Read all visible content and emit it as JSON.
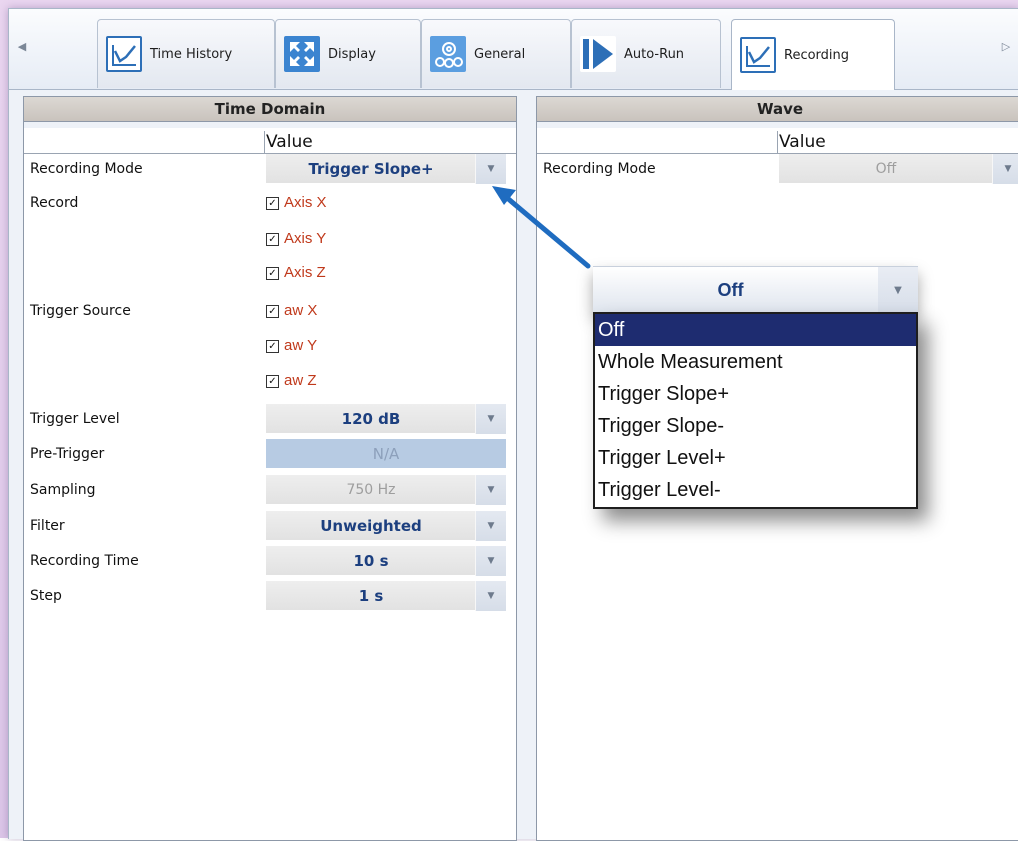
{
  "tabs": {
    "scroll_left": "◀",
    "scroll_right": "▷",
    "items": [
      {
        "label": "Time History",
        "icon": "line-chart-icon"
      },
      {
        "label": "Display",
        "icon": "expand-arrows-icon"
      },
      {
        "label": "General",
        "icon": "gears-icon"
      },
      {
        "label": "Auto-Run",
        "icon": "play-icon"
      },
      {
        "label": "Recording",
        "icon": "line-chart-icon",
        "active": true
      }
    ]
  },
  "time_domain": {
    "title": "Time Domain",
    "value_header": "Value",
    "recording_mode": {
      "label": "Recording Mode",
      "value": "Trigger Slope+"
    },
    "record": {
      "label": "Record",
      "items": [
        {
          "label": "Axis X",
          "checked": true
        },
        {
          "label": "Axis Y",
          "checked": true
        },
        {
          "label": "Axis Z",
          "checked": true
        }
      ]
    },
    "trigger_source": {
      "label": "Trigger Source",
      "items": [
        {
          "label": "aw X",
          "checked": true
        },
        {
          "label": "aw Y",
          "checked": true
        },
        {
          "label": "aw Z",
          "checked": true
        }
      ]
    },
    "trigger_level": {
      "label": "Trigger Level",
      "value": "120 dB"
    },
    "pre_trigger": {
      "label": "Pre-Trigger",
      "value": "N/A"
    },
    "sampling": {
      "label": "Sampling",
      "value": "750 Hz"
    },
    "filter": {
      "label": "Filter",
      "value": "Unweighted"
    },
    "recording_time": {
      "label": "Recording Time",
      "value": "10 s"
    },
    "step": {
      "label": "Step",
      "value": "1 s"
    }
  },
  "wave": {
    "title": "Wave",
    "value_header": "Value",
    "recording_mode": {
      "label": "Recording Mode",
      "value": "Off"
    }
  },
  "popup": {
    "current": "Off",
    "options": [
      "Off",
      "Whole Measurement",
      "Trigger Slope+",
      "Trigger Slope-",
      "Trigger Level+",
      "Trigger Level-"
    ],
    "selected_index": 0
  },
  "colors": {
    "checkbox_label": "#c0391b",
    "value_text": "#1c3f7f",
    "selected_option_bg": "#1e2c70",
    "annotation_arrow": "#1f6cc0"
  }
}
